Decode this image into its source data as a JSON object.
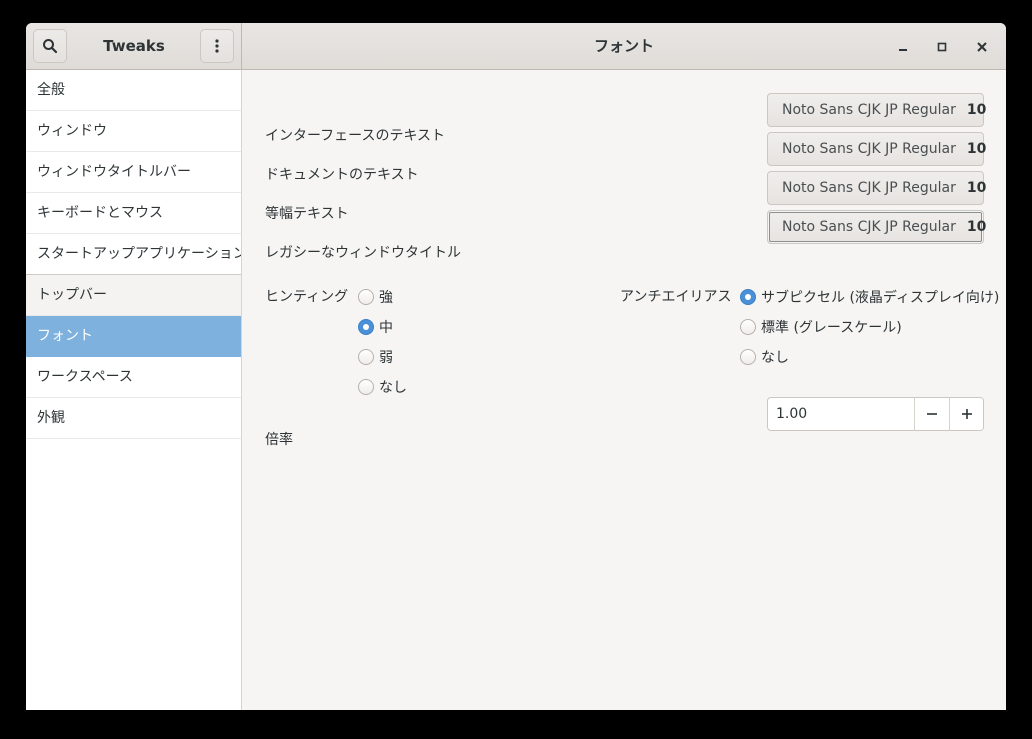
{
  "header": {
    "sidebar_title": "Tweaks",
    "title": "フォント",
    "search_icon": "search-icon",
    "menu_icon": "vertical-dots-icon",
    "window_controls": [
      "minimize-icon",
      "maximize-icon",
      "close-icon"
    ]
  },
  "sidebar": {
    "items": [
      {
        "label": "全般"
      },
      {
        "label": "ウィンドウ"
      },
      {
        "label": "ウィンドウタイトルバー"
      },
      {
        "label": "キーボードとマウス"
      },
      {
        "label": "スタートアップアプリケーション"
      },
      {
        "label": "トップバー"
      },
      {
        "label": "フォント",
        "selected": true
      },
      {
        "label": "ワークスペース"
      },
      {
        "label": "外観"
      }
    ]
  },
  "fonts": {
    "rows": [
      {
        "label": "インターフェースのテキスト",
        "font": "Noto Sans CJK JP Regular",
        "size": "10"
      },
      {
        "label": "ドキュメントのテキスト",
        "font": "Noto Sans CJK JP Regular",
        "size": "10"
      },
      {
        "label": "等幅テキスト",
        "font": "Noto Sans CJK JP Regular",
        "size": "10"
      },
      {
        "label": "レガシーなウィンドウタイトル",
        "font": "Noto Sans CJK JP Regular",
        "size": "10"
      }
    ]
  },
  "hinting": {
    "label": "ヒンティング",
    "options": [
      "強",
      "中",
      "弱",
      "なし"
    ],
    "selected": "中"
  },
  "antialiasing": {
    "label": "アンチエイリアス",
    "options": [
      "サブピクセル (液晶ディスプレイ向け)",
      "標準 (グレースケール)",
      "なし"
    ],
    "selected": "サブピクセル (液晶ディスプレイ向け)"
  },
  "scaling": {
    "label": "倍率",
    "value": "1.00"
  },
  "colors": {
    "accent": "#4a90d9",
    "sidebar_selected": "#7eb1dd"
  }
}
